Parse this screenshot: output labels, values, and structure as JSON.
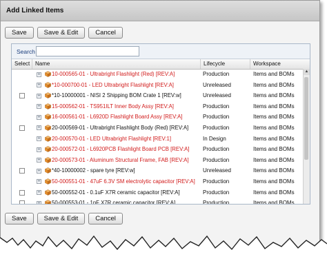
{
  "dialog": {
    "title": "Add Linked Items"
  },
  "buttons": {
    "save": "Save",
    "save_edit": "Save & Edit",
    "cancel": "Cancel"
  },
  "search": {
    "label": "Search",
    "value": ""
  },
  "columns": {
    "select": "Select",
    "name": "Name",
    "lifecycle": "Lifecycle",
    "workspace": "Workspace"
  },
  "colors": {
    "highlight_text": "#d11a1a",
    "header_text": "#1a3d7c",
    "item_icon": "#e8902a"
  },
  "rows": [
    {
      "name": "10-000565-01 - Ultrabright Flashlight (Red) [REV:A]",
      "lifecycle": "Production",
      "workspace": "Items and BOMs",
      "highlight": true,
      "checkbox": false
    },
    {
      "name": "*10-000700-01 - LED Ultrabright Flashlight [REV:A]",
      "lifecycle": "Unreleased",
      "workspace": "Items and BOMs",
      "highlight": true,
      "checkbox": false
    },
    {
      "name": "*10-10000001 - NISI 2 Shipping BOM Crate 1 [REV:w]",
      "lifecycle": "Unreleased",
      "workspace": "Items and BOMs",
      "highlight": false,
      "checkbox": true
    },
    {
      "name": "15-000562-01 - TS951ILT Inner Body Assy [REV:A]",
      "lifecycle": "Production",
      "workspace": "Items and BOMs",
      "highlight": true,
      "checkbox": false
    },
    {
      "name": "16-000561-01 - L6920D Flashlight Board Assy [REV:A]",
      "lifecycle": "Production",
      "workspace": "Items and BOMs",
      "highlight": true,
      "checkbox": false
    },
    {
      "name": "20-000569-01 - Ultrabright Flashlight Body (Red) [REV:A]",
      "lifecycle": "Production",
      "workspace": "Items and BOMs",
      "highlight": false,
      "checkbox": true
    },
    {
      "name": "20-000570-01 - LED Ultrabright Flashlight [REV:1]",
      "lifecycle": "In Design",
      "workspace": "Items and BOMs",
      "highlight": true,
      "checkbox": false
    },
    {
      "name": "20-000572-01 - L6920PCB Flashlight Board PCB [REV:A]",
      "lifecycle": "Production",
      "workspace": "Items and BOMs",
      "highlight": true,
      "checkbox": false
    },
    {
      "name": "20-000573-01 - Aluminum Structural Frame, FAB [REV:A]",
      "lifecycle": "Production",
      "workspace": "Items and BOMs",
      "highlight": true,
      "checkbox": false
    },
    {
      "name": "*40-10000002 - spare tyre [REV:w]",
      "lifecycle": "Unreleased",
      "workspace": "Items and BOMs",
      "highlight": false,
      "checkbox": true
    },
    {
      "name": "50-000551-01 - 47uF 6.3V SM electrolytic capacitor [REV:A]",
      "lifecycle": "Production",
      "workspace": "Items and BOMs",
      "highlight": true,
      "checkbox": false
    },
    {
      "name": "50-000552-01 - 0.1uF X7R ceramic capacitor [REV:A]",
      "lifecycle": "Production",
      "workspace": "Items and BOMs",
      "highlight": false,
      "checkbox": true
    },
    {
      "name": "50-000553-01 - 1nF X7R ceramic capacitor [REV:A]",
      "lifecycle": "Production",
      "workspace": "Items and BOMs",
      "highlight": false,
      "checkbox": true
    }
  ]
}
